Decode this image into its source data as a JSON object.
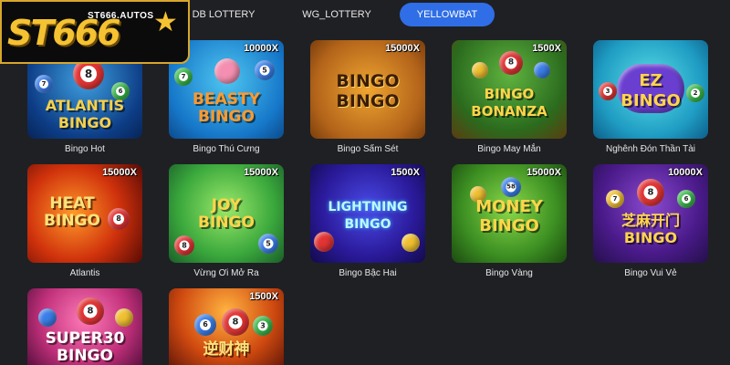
{
  "header": {
    "tabs": [
      {
        "label": "DB LOTTERY",
        "active": false
      },
      {
        "label": "WG_LOTTERY",
        "active": false
      },
      {
        "label": "YELLOWBAT",
        "active": true
      }
    ],
    "logo": {
      "big_text": "ST666",
      "small_text": "ST666.AUTOS",
      "accent": "#f5c232"
    }
  },
  "games": [
    {
      "name": "Bingo Hot",
      "multiplier": "",
      "art_title": "ATLANTIS\nBINGO"
    },
    {
      "name": "Bingo Thú Cưng",
      "multiplier": "10000X",
      "art_title": "BEASTY\nBINGO"
    },
    {
      "name": "Bingo Sấm Sét",
      "multiplier": "15000X",
      "art_title": "BINGO\nBINGO"
    },
    {
      "name": "Bingo May Mắn",
      "multiplier": "1500X",
      "art_title": "BINGO\nBONANZA"
    },
    {
      "name": "Nghênh Đón Thần Tài",
      "multiplier": "",
      "art_title": "EZ\nBINGO"
    },
    {
      "name": "Atlantis",
      "multiplier": "15000X",
      "art_title": "HEAT\nBINGO"
    },
    {
      "name": "Vừng Ơi Mở Ra",
      "multiplier": "15000X",
      "art_title": "JOY\nBINGO"
    },
    {
      "name": "Bingo Bậc Hai",
      "multiplier": "1500X",
      "art_title": "LIGHTNING\nBINGO"
    },
    {
      "name": "Bingo Vàng",
      "multiplier": "15000X",
      "art_title": "MONEY\nBINGO"
    },
    {
      "name": "Bingo Vui Vẻ",
      "multiplier": "10000X",
      "art_title": "芝麻开门\nBINGO"
    },
    {
      "name": "",
      "multiplier": "",
      "art_title": "SUPER30\nBINGO"
    },
    {
      "name": "",
      "multiplier": "1500X",
      "art_title": "逆财神"
    }
  ]
}
